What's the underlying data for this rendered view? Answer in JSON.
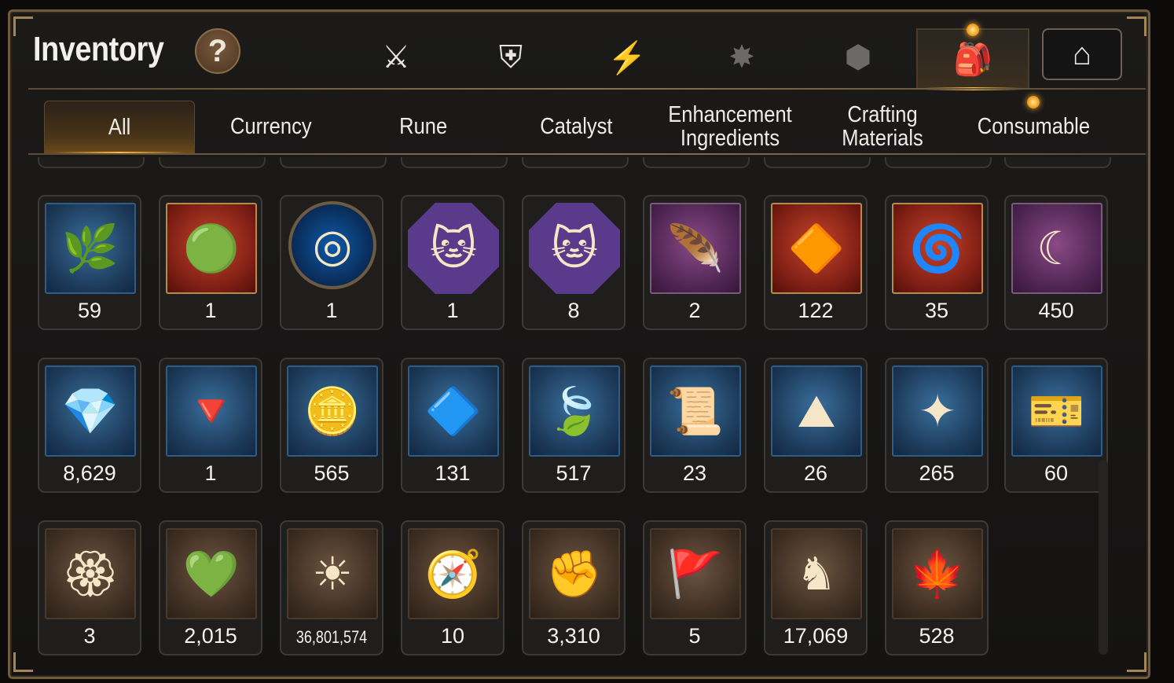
{
  "header": {
    "title": "Inventory",
    "help_label": "?"
  },
  "category_tabs": [
    {
      "name": "hero-equipment-icon",
      "glyph": "⚔"
    },
    {
      "name": "broken-shield-icon",
      "glyph": "⛨"
    },
    {
      "name": "lightning-icon",
      "glyph": "⚡"
    },
    {
      "name": "sword-burst-icon",
      "glyph": "✸"
    },
    {
      "name": "cube-icon",
      "glyph": "⬢"
    },
    {
      "name": "backpack-icon",
      "glyph": "🎒",
      "active": true
    },
    {
      "name": "storehouse-icon",
      "glyph": "⌂"
    }
  ],
  "sub_tabs": [
    {
      "label": "All",
      "active": true
    },
    {
      "label": "Currency"
    },
    {
      "label": "Rune"
    },
    {
      "label": "Catalyst"
    },
    {
      "label": "Enhancement Ingredients"
    },
    {
      "label": "Crafting Materials"
    },
    {
      "label": "Consumable"
    }
  ],
  "items": [
    {
      "name": "ginseng-root-icon",
      "glyph": "🌿",
      "frame": "blue",
      "qty": "59"
    },
    {
      "name": "green-orb-icon",
      "glyph": "🟢",
      "frame": "red",
      "qty": "1"
    },
    {
      "name": "blue-rune-circle-icon",
      "glyph": "◎",
      "frame": "round",
      "qty": "1"
    },
    {
      "name": "pet-food-bag-icon",
      "glyph": "🐱",
      "frame": "octo",
      "qty": "1"
    },
    {
      "name": "pet-food-icon",
      "glyph": "🐱",
      "frame": "octo",
      "qty": "8"
    },
    {
      "name": "feather-wand-icon",
      "glyph": "🪶",
      "frame": "purple",
      "qty": "2"
    },
    {
      "name": "amber-crystal-icon",
      "glyph": "🔶",
      "frame": "red",
      "qty": "122"
    },
    {
      "name": "yoyo-icon",
      "glyph": "🌀",
      "frame": "red",
      "qty": "35"
    },
    {
      "name": "crescent-charm-icon",
      "glyph": "☾",
      "frame": "purple",
      "qty": "450"
    },
    {
      "name": "blue-gem-icon",
      "glyph": "💎",
      "frame": "blue",
      "qty": "8,629"
    },
    {
      "name": "pendulum-icon",
      "glyph": "🔻",
      "frame": "blue",
      "qty": "1"
    },
    {
      "name": "silver-coin-icon",
      "glyph": "🪙",
      "frame": "blue",
      "qty": "565"
    },
    {
      "name": "teal-crystal-icon",
      "glyph": "🔷",
      "frame": "blue",
      "qty": "131"
    },
    {
      "name": "green-leaf-icon",
      "glyph": "🍃",
      "frame": "blue",
      "qty": "517"
    },
    {
      "name": "pet-certificate-icon",
      "glyph": "📜",
      "frame": "blue",
      "qty": "23"
    },
    {
      "name": "pink-crystal-pile-icon",
      "glyph": "⛰",
      "frame": "blue",
      "qty": "26"
    },
    {
      "name": "star-compass-icon",
      "glyph": "✦",
      "frame": "blue",
      "qty": "265"
    },
    {
      "name": "costume-ticket-icon",
      "glyph": "🎫",
      "frame": "blue",
      "qty": "60"
    },
    {
      "name": "red-seal-badge-icon",
      "glyph": "🏵",
      "frame": "brown",
      "qty": "3"
    },
    {
      "name": "green-heart-icon",
      "glyph": "💚",
      "frame": "brown",
      "qty": "2,015"
    },
    {
      "name": "sun-coin-icon",
      "glyph": "☀",
      "frame": "brown",
      "qty": "36,801,574",
      "small": true
    },
    {
      "name": "stone-compass-icon",
      "glyph": "🧭",
      "frame": "brown",
      "qty": "10"
    },
    {
      "name": "fist-emblem-icon",
      "glyph": "✊",
      "frame": "brown",
      "qty": "3,310"
    },
    {
      "name": "battle-banner-icon",
      "glyph": "🚩",
      "frame": "brown",
      "qty": "5"
    },
    {
      "name": "chess-knight-icon",
      "glyph": "♞",
      "frame": "brown",
      "qty": "17,069"
    },
    {
      "name": "red-leaf-icon",
      "glyph": "🍁",
      "frame": "brown",
      "qty": "528"
    }
  ]
}
